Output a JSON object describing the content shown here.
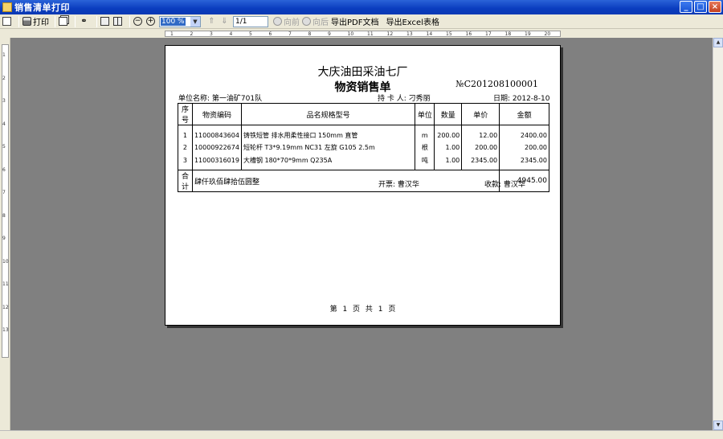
{
  "window": {
    "title": "销售清单打印"
  },
  "toolbar": {
    "print_label": "打印",
    "zoom_value": "100 %",
    "page_value": "1/1",
    "prev_label": "向前",
    "next_label": "向后",
    "export_pdf_label": "导出PDF文档",
    "export_excel_label": "导出Excel表格"
  },
  "ruler": {
    "h_ticks": [
      "1",
      "2",
      "3",
      "4",
      "5",
      "6",
      "7",
      "8",
      "9",
      "10",
      "11",
      "12",
      "13",
      "14",
      "15",
      "16",
      "17",
      "18",
      "19",
      "20"
    ],
    "v_ticks": [
      "1",
      "2",
      "3",
      "4",
      "5",
      "6",
      "7",
      "8",
      "9",
      "10",
      "11",
      "12",
      "13"
    ]
  },
  "document": {
    "company": "大庆油田采油七厂",
    "title": "物资销售单",
    "number": "№C201208100001",
    "unit": "单位名称: 第一油矿701队",
    "holder": "持 卡 人: 刁秀丽",
    "date": "日期: 2012-8-10",
    "columns": [
      "序号",
      "物资编码",
      "品名规格型号",
      "单位",
      "数量",
      "单价",
      "金额"
    ],
    "rows": [
      [
        "1",
        "11000843604",
        "铸铁短管 排水用柔性接口 150mm 直管",
        "m",
        "200.00",
        "12.00",
        "2400.00"
      ],
      [
        "2",
        "10000922674",
        "短轮杆 T3*9.19mm NC31 左旋 G105 2.5m",
        "根",
        "1.00",
        "200.00",
        "200.00"
      ],
      [
        "3",
        "11000316019",
        "大槽钢 180*70*9mm Q235A",
        "吨",
        "1.00",
        "2345.00",
        "2345.00"
      ]
    ],
    "total_label": "合计",
    "total_words": "肆仟玖佰肆拾伍圆整",
    "total_amount": "4945.00",
    "issuer": "开票: 曹汉华",
    "payee": "收款: 曹汉华",
    "page_info": "第 1 页 共 1 页"
  }
}
